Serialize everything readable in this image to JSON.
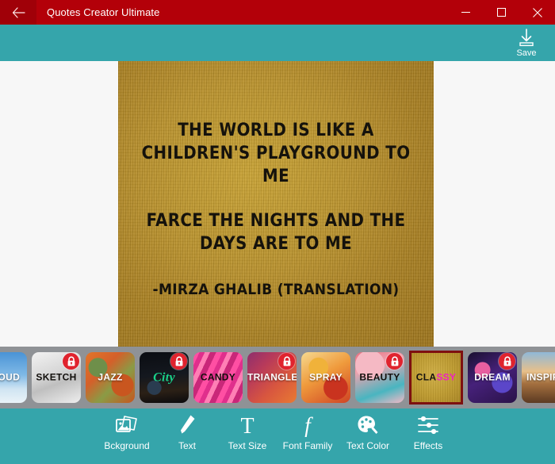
{
  "titlebar": {
    "back_icon": "back-arrow-icon",
    "title": "Quotes Creator Ultimate",
    "minimize_label": "–",
    "maximize_label": "□",
    "close_label": "✕",
    "bg_color": "#b30009"
  },
  "header": {
    "bg_color": "#35a5ab",
    "save_label": "Save",
    "save_icon": "download-icon"
  },
  "canvas": {
    "background_style": "classy-gold-canvas-texture",
    "text_color": "#15120c",
    "lines": [
      "THE WORLD IS LIKE A",
      "CHILDREN'S PLAYGROUND TO",
      "ME"
    ],
    "lines2": [
      "FARCE THE NIGHTS AND THE",
      "DAYS ARE TO ME"
    ],
    "author": "-MIRZA GHALIB (TRANSLATION)"
  },
  "thumbnails": {
    "strip_bg": "#8f9296",
    "selected_border_color": "#7e1010",
    "items": [
      {
        "id": "cloud",
        "label": "CLOUD",
        "art": "art-cloud",
        "label_class": "lbl-white",
        "locked": false,
        "selected": false,
        "clipped": true
      },
      {
        "id": "sketch",
        "label": "SKETCH",
        "art": "art-sketch",
        "label_class": "lbl-black",
        "locked": true,
        "selected": false,
        "clipped": false
      },
      {
        "id": "jazz",
        "label": "JAZZ",
        "art": "art-jazz",
        "label_class": "lbl-white",
        "locked": false,
        "selected": false,
        "clipped": false
      },
      {
        "id": "city",
        "label": "City",
        "art": "art-city",
        "label_class": "lbl-green",
        "locked": true,
        "selected": false,
        "clipped": false
      },
      {
        "id": "candy",
        "label": "CANDY",
        "art": "art-candy",
        "label_class": "lbl-black",
        "locked": false,
        "selected": false,
        "clipped": false
      },
      {
        "id": "triangle",
        "label": "TRIANGLE",
        "art": "art-triangle",
        "label_class": "lbl-white",
        "locked": true,
        "selected": false,
        "clipped": false
      },
      {
        "id": "spray",
        "label": "SPRAY",
        "art": "art-spray",
        "label_class": "lbl-white",
        "locked": false,
        "selected": false,
        "clipped": false
      },
      {
        "id": "beauty",
        "label": "BEAUTY",
        "art": "art-beauty",
        "label_class": "lbl-black",
        "locked": true,
        "selected": false,
        "clipped": false
      },
      {
        "id": "classy",
        "label": "CLASSY",
        "art": "art-classy",
        "label_class": "lbl-black",
        "locked": false,
        "selected": true,
        "clipped": false,
        "label_part_a": "CLA",
        "label_part_b": "SSY"
      },
      {
        "id": "dream",
        "label": "DREAM",
        "art": "art-dream",
        "label_class": "lbl-white",
        "locked": true,
        "selected": false,
        "clipped": false
      },
      {
        "id": "inspire",
        "label": "INSPIRE",
        "art": "art-inspire",
        "label_class": "lbl-white",
        "locked": false,
        "selected": false,
        "clipped": true
      }
    ]
  },
  "toolbar": {
    "bg_color": "#35a5ab",
    "items": [
      {
        "id": "background",
        "label": "Bckground",
        "icon": "image-stack-icon"
      },
      {
        "id": "text",
        "label": "Text",
        "icon": "pen-icon"
      },
      {
        "id": "text-size",
        "label": "Text Size",
        "icon": "letter-t-icon"
      },
      {
        "id": "font-family",
        "label": "Font Family",
        "icon": "script-f-icon"
      },
      {
        "id": "text-color",
        "label": "Text Color",
        "icon": "palette-icon"
      },
      {
        "id": "effects",
        "label": "Effects",
        "icon": "sliders-icon"
      }
    ]
  }
}
